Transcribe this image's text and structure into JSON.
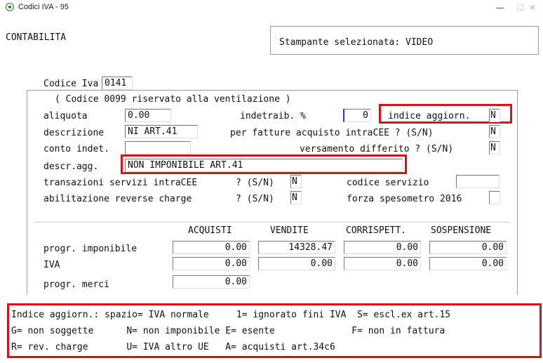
{
  "window": {
    "title": "Codici IVA - 95",
    "minimize": "—",
    "maximize": "☐",
    "close": "✕"
  },
  "header": {
    "section": "CONTABILITA",
    "printer": "Stampante selezionata: VIDEO"
  },
  "codice": {
    "label": "Codice Iva",
    "value": "0141"
  },
  "note": "( Codice 0099 riservato alla ventilazione )",
  "form": {
    "aliquota_label": "aliquota",
    "aliquota_value": "0.00",
    "indetraib_label": "indetraib. %",
    "indetraib_value": "0",
    "indice_label": "indice aggiorn.",
    "indice_value": "N",
    "descrizione_label": "descrizione",
    "descrizione_value": "NI ART.41",
    "intracee_label": "per fatture acquisto intraCEE ? (S/N)",
    "intracee_value": "N",
    "conto_label": "conto indet.",
    "conto_value": "",
    "versamento_label": "versamento differito ? (S/N)",
    "versamento_value": "N",
    "descragg_label": "descr.agg.",
    "descragg_value": "NON IMPONIBILE ART.41",
    "transazioni_label": "transazioni servizi intraCEE",
    "transazioni_q": "? (S/N)",
    "transazioni_value": "N",
    "codserv_label": "codice servizio",
    "codserv_value": "",
    "reverse_label": "abilitazione reverse charge",
    "reverse_q": "? (S/N)",
    "reverse_value": "N",
    "spesometro_label": "forza spesometro 2016",
    "spesometro_value": ""
  },
  "table": {
    "headers": [
      "ACQUISTI",
      "VENDITE",
      "CORRISPETT.",
      "SOSPENSIONE"
    ],
    "rows": [
      {
        "label": "progr. imponibile",
        "values": [
          "0.00",
          "14328.47",
          "0.00",
          "0.00"
        ]
      },
      {
        "label": "IVA",
        "values": [
          "0.00",
          "0.00",
          "0.00",
          "0.00"
        ]
      },
      {
        "label": "progr. merci",
        "values": [
          "0.00"
        ]
      }
    ]
  },
  "legend": {
    "line1": "Indice aggiorn.: spazio= IVA normale     1= ignorato fini IVA  S= escl.ex art.15",
    "line2": "G= non soggette      N= non imponibile E= esente              F= non in fattura",
    "line3": "R= rev. charge       U= IVA altro UE   A= acquisti art.34c6"
  },
  "colors": {
    "highlight": "#d1161b",
    "caret": "#1f3fd6"
  }
}
